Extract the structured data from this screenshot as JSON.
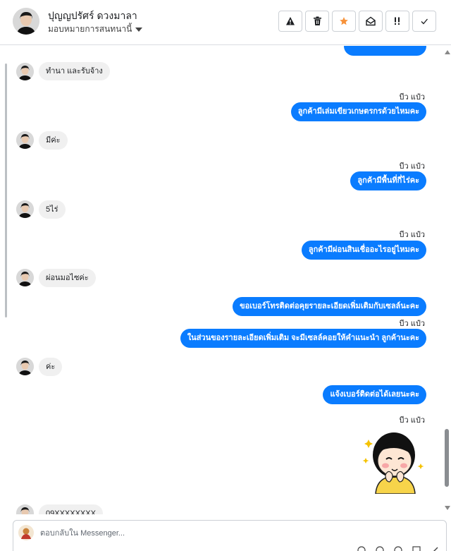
{
  "header": {
    "name": "ปุญญปรัศร์ ดวงมาลา",
    "subtitle": "มอบหมายการสนทนานี้",
    "actions": [
      {
        "name": "report-spam-button",
        "icon": "warning-icon"
      },
      {
        "name": "delete-button",
        "icon": "trash-icon"
      },
      {
        "name": "star-button",
        "icon": "star-icon",
        "color": "#f7923a"
      },
      {
        "name": "mark-unread-button",
        "icon": "envelope-open-icon"
      },
      {
        "name": "priority-button",
        "icon": "priority-icon"
      },
      {
        "name": "mark-done-button",
        "icon": "check-icon"
      }
    ]
  },
  "messages": {
    "m1": "ทำนา และรับจ้าง",
    "seen1": "บีว แป๋ว",
    "m2": "ลูกค้ามีเล่มเขียวเกษตรกรด้วยไหมคะ",
    "m3": "มีค่ะ",
    "seen2": "บีว แป๋ว",
    "m4": "ลูกค้ามีพื้นที่กี่ไร่คะ",
    "m5": "5ไร่",
    "seen3": "บีว แป๋ว",
    "m6": "ลูกค้ามีผ่อนสินเชื่ออะไรอยู่ไหมคะ",
    "m7": "ผ่อนมอไซค่ะ",
    "m8": "ขอเบอร์โทรติดต่อคุยรายละเอียดเพิ่มเติมกับเซลล์นะคะ",
    "seen4": "บีว แป๋ว",
    "m9": "ในส่วนของรายละเอียดเพิ่มเติม จะมีเซลล์คอยให้คำแนะนำ ลูกค้านะคะ",
    "m10": "ค่ะ",
    "m11": "แจ้งเบอร์ติดต่อได้เลยนะคะ",
    "seen5": "บีว แป๋ว",
    "m12": "09XXXXXXXX"
  },
  "composer": {
    "placeholder": "ตอบกลับใน Messenger..."
  },
  "colors": {
    "outgoing": "#0a7cff",
    "incoming": "#f0f0f0",
    "accent_star": "#f7923a"
  }
}
